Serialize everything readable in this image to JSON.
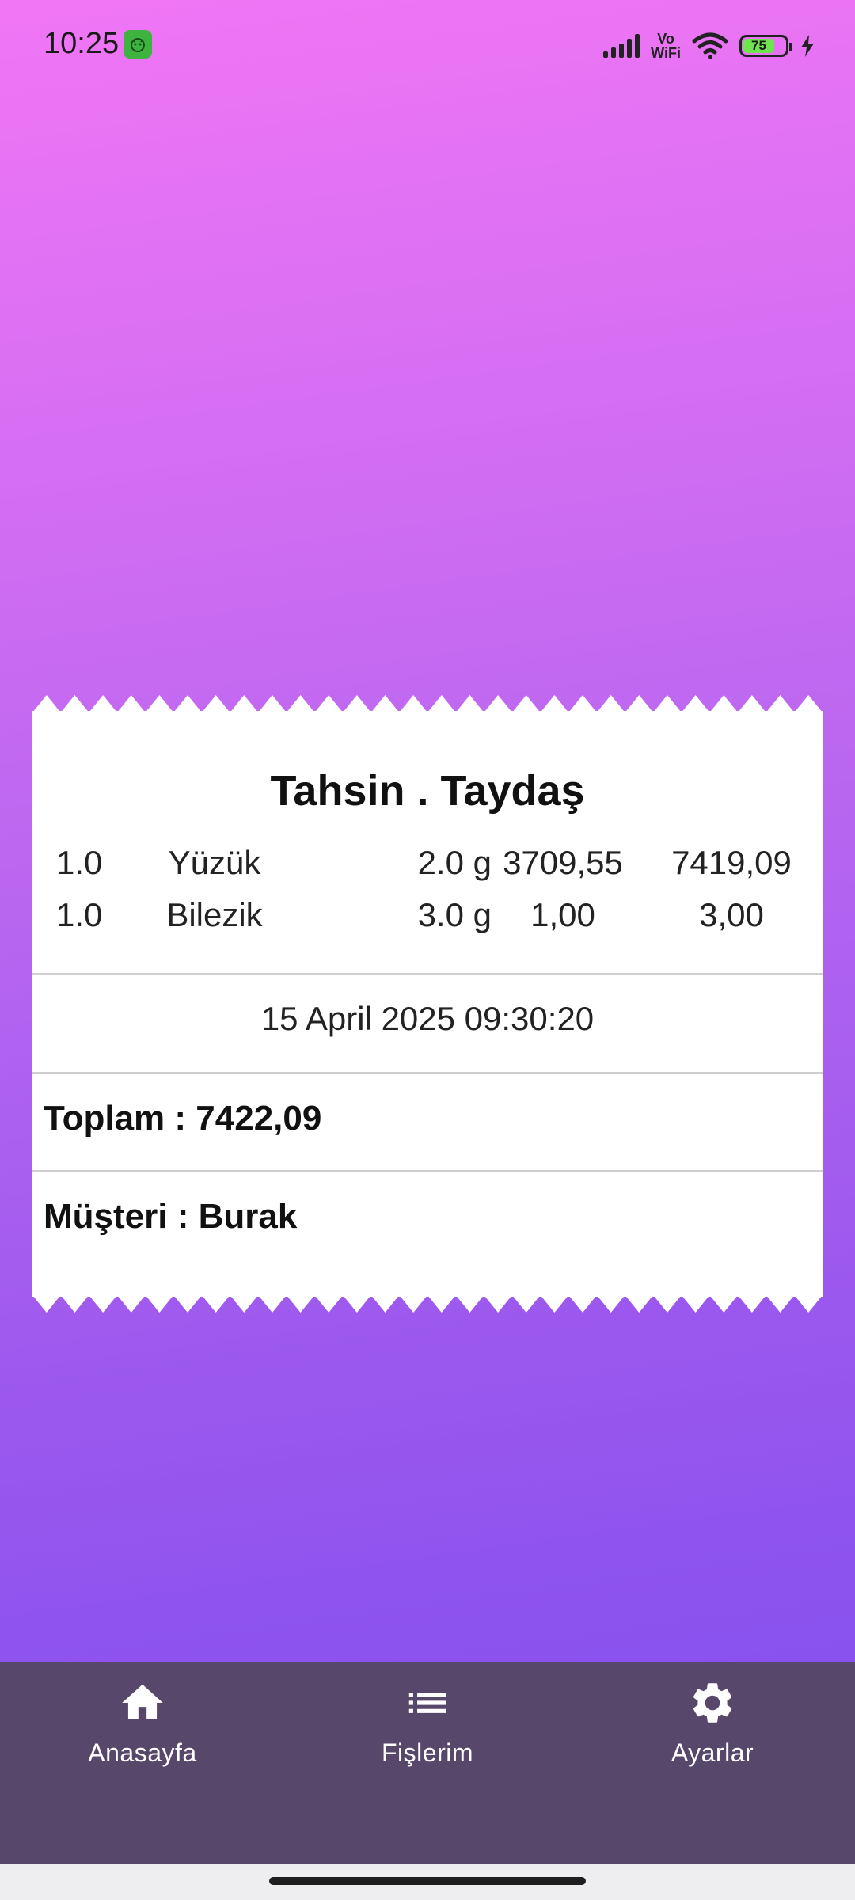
{
  "status_bar": {
    "time": "10:25",
    "network_label_top": "Vo",
    "network_label_bottom": "WiFi",
    "battery_level": "75"
  },
  "receipt": {
    "title": "Tahsin . Taydaş",
    "items": [
      {
        "qty": "1.0",
        "name": "Yüzük",
        "weight": "2.0 g",
        "price": "3709,55",
        "total": "7419,09"
      },
      {
        "qty": "1.0",
        "name": "Bilezik",
        "weight": "3.0 g",
        "price": "1,00",
        "total": "3,00"
      }
    ],
    "date": "15 April 2025 09:30:20",
    "total_line": "Toplam : 7422,09",
    "customer_line": "Müşteri : Burak"
  },
  "nav": {
    "home_label": "Anasayfa",
    "receipts_label": "Fişlerim",
    "settings_label": "Ayarlar"
  },
  "colors": {
    "nav_background": "#57476a",
    "battery_fill": "#6ee44f"
  }
}
